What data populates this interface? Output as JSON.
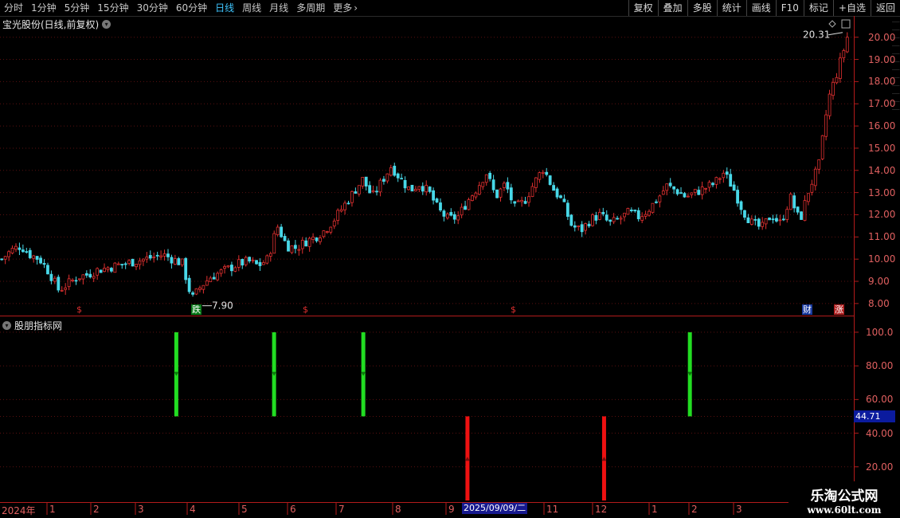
{
  "toolbar": {
    "periods": [
      "分时",
      "1分钟",
      "5分钟",
      "15分钟",
      "30分钟",
      "60分钟",
      "日线",
      "周线",
      "月线",
      "多周期",
      "更多"
    ],
    "active_period": "日线",
    "buttons": [
      "复权",
      "叠加",
      "多股",
      "统计",
      "画线",
      "F10",
      "标记",
      "+自选",
      "返回"
    ]
  },
  "main": {
    "title": "宝光股份(日线,前复权)",
    "high_label": "20.31",
    "low_label": "7.90",
    "markers": [
      "$",
      "跌",
      "$",
      "$",
      "财",
      "涨"
    ]
  },
  "sub": {
    "title": "股朋指标网",
    "last_value": "44.71"
  },
  "y_axis_main": [
    "20.00",
    "19.00",
    "18.00",
    "17.00",
    "16.00",
    "15.00",
    "14.00",
    "13.00",
    "12.00",
    "11.00",
    "10.00",
    "9.00",
    "8.00"
  ],
  "y_axis_sub": [
    "100.0",
    "80.00",
    "60.00",
    "40.00",
    "20.00"
  ],
  "x_axis": {
    "year_label": "2024年",
    "months": [
      "1",
      "2",
      "3",
      "4",
      "5",
      "6",
      "7",
      "8",
      "9",
      "11",
      "12",
      "1",
      "2",
      "3"
    ],
    "cursor_date": "2025/09/09/二"
  },
  "watermark": {
    "line1": "乐淘公式网",
    "line2": "www.60lt.com"
  },
  "colors": {
    "up": "#e03030",
    "down": "#48d8e8",
    "signal_green": "#22dd22",
    "signal_red": "#ee1111"
  },
  "chart_data": {
    "type": "candlestick",
    "price_ylim": [
      7.6,
      20.6
    ],
    "price_path": [
      10.0,
      10.4,
      10.6,
      10.2,
      10.0,
      9.4,
      8.6,
      8.9,
      9.2,
      9.3,
      9.5,
      9.6,
      9.7,
      9.8,
      9.9,
      10.0,
      10.1,
      10.2,
      10.0,
      9.8,
      8.2,
      8.8,
      9.2,
      9.4,
      9.6,
      9.8,
      9.9,
      9.7,
      10.0,
      11.5,
      10.6,
      10.5,
      10.8,
      11.0,
      11.3,
      11.8,
      12.4,
      13.0,
      13.6,
      12.8,
      13.5,
      14.2,
      13.6,
      13.1,
      13.4,
      13.0,
      12.2,
      11.8,
      11.9,
      12.6,
      13.2,
      13.9,
      12.8,
      13.4,
      12.3,
      12.6,
      13.4,
      14.1,
      13.2,
      12.6,
      11.5,
      11.3,
      11.8,
      12.0,
      11.6,
      11.8,
      12.1,
      11.9,
      12.2,
      12.7,
      13.3,
      13.1,
      12.8,
      13.0,
      13.2,
      13.4,
      13.9,
      13.2,
      12.2,
      11.6,
      11.4,
      12.0,
      11.6,
      12.8,
      11.7,
      13.2,
      14.2,
      17.2,
      18.5,
      20.0
    ],
    "signals": {
      "green_bars": [
        {
          "x_frac": 0.2065,
          "from": 50,
          "to": 100
        },
        {
          "x_frac": 0.321,
          "from": 50,
          "to": 100
        },
        {
          "x_frac": 0.4255,
          "from": 50,
          "to": 100
        },
        {
          "x_frac": 0.808,
          "from": 50,
          "to": 100
        }
      ],
      "red_bars": [
        {
          "x_frac": 0.5475,
          "from": 0,
          "to": 50
        },
        {
          "x_frac": 0.7075,
          "from": 0,
          "to": 50
        }
      ]
    },
    "sub_ylim": [
      0,
      108
    ]
  }
}
